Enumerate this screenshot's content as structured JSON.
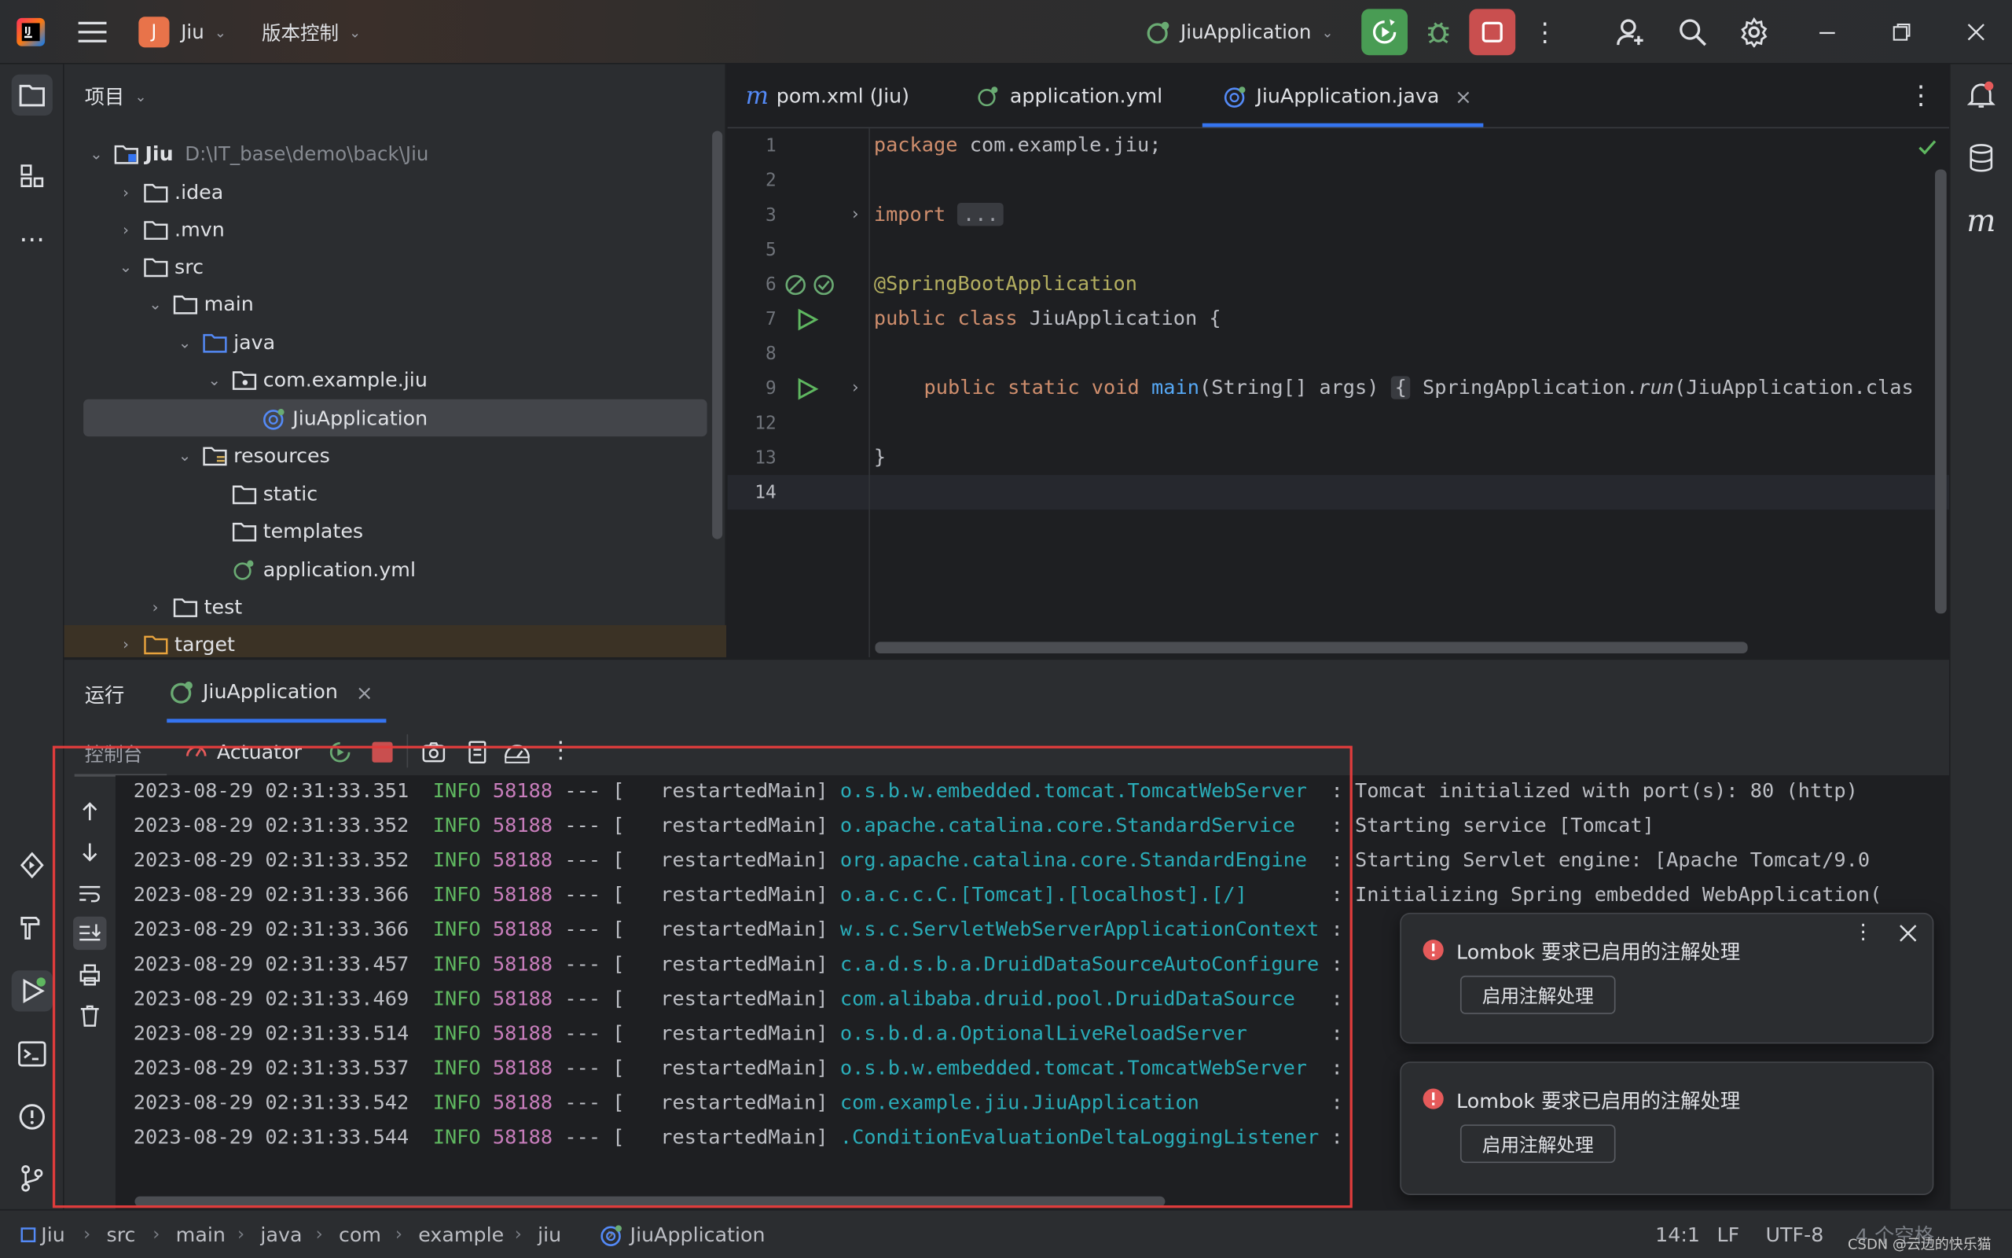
{
  "titlebar": {
    "project_initial": "J",
    "project_name": "Jiu",
    "vcs_label": "版本控制",
    "run_config": "JiuApplication"
  },
  "project_panel": {
    "title": "项目",
    "tree": [
      {
        "label": "Jiu",
        "path": "D:\\IT_base\\demo\\back\\Jiu"
      },
      {
        "label": ".idea"
      },
      {
        "label": ".mvn"
      },
      {
        "label": "src"
      },
      {
        "label": "main"
      },
      {
        "label": "java"
      },
      {
        "label": "com.example.jiu"
      },
      {
        "label": "JiuApplication"
      },
      {
        "label": "resources"
      },
      {
        "label": "static"
      },
      {
        "label": "templates"
      },
      {
        "label": "application.yml"
      },
      {
        "label": "test"
      },
      {
        "label": "target"
      }
    ]
  },
  "editor": {
    "tabs": [
      {
        "label": "pom.xml (Jiu)"
      },
      {
        "label": "application.yml"
      },
      {
        "label": "JiuApplication.java"
      }
    ],
    "line_numbers": [
      "1",
      "2",
      "3",
      "5",
      "6",
      "7",
      "8",
      "9",
      "12",
      "13",
      "14"
    ],
    "code": {
      "l1_kw": "package",
      "l1_rest": " com.example.jiu;",
      "l3_kw": "import",
      "l3_fold": "...",
      "l6": "@SpringBootApplication",
      "l7_kw": "public class",
      "l7_rest": " JiuApplication {",
      "l9_kw": "public static void",
      "l9_fn": "main",
      "l9_args": "(String[] args)",
      "l9_brace": "{",
      "l9_call_a": " SpringApplication.",
      "l9_call_run": "run",
      "l9_call_b": "(JiuApplication.clas",
      "l13": "}"
    }
  },
  "run_panel": {
    "title": "运行",
    "tab_label": "JiuApplication",
    "console_tab": "控制台",
    "actuator_tab": "Actuator",
    "logs": [
      {
        "ts": "2023-08-29 02:31:33.351",
        "lvl": "INFO",
        "pid": "58188",
        "sep": "--- [",
        "thr": "  restartedMain]",
        "cls": "o.s.b.w.embedded.tomcat.TomcatWebServer ",
        "msg": " : Tomcat initialized with port(s): 80 (http)"
      },
      {
        "ts": "2023-08-29 02:31:33.352",
        "lvl": "INFO",
        "pid": "58188",
        "sep": "--- [",
        "thr": "  restartedMain]",
        "cls": "o.apache.catalina.core.StandardService  ",
        "msg": " : Starting service [Tomcat]"
      },
      {
        "ts": "2023-08-29 02:31:33.352",
        "lvl": "INFO",
        "pid": "58188",
        "sep": "--- [",
        "thr": "  restartedMain]",
        "cls": "org.apache.catalina.core.StandardEngine ",
        "msg": " : Starting Servlet engine: [Apache Tomcat/9.0"
      },
      {
        "ts": "2023-08-29 02:31:33.366",
        "lvl": "INFO",
        "pid": "58188",
        "sep": "--- [",
        "thr": "  restartedMain]",
        "cls": "o.a.c.c.C.[Tomcat].[localhost].[/]      ",
        "msg": " : Initializing Spring embedded WebApplication("
      },
      {
        "ts": "2023-08-29 02:31:33.366",
        "lvl": "INFO",
        "pid": "58188",
        "sep": "--- [",
        "thr": "  restartedMain]",
        "cls": "w.s.c.ServletWebServerApplicationContext",
        "msg": " :"
      },
      {
        "ts": "2023-08-29 02:31:33.457",
        "lvl": "INFO",
        "pid": "58188",
        "sep": "--- [",
        "thr": "  restartedMain]",
        "cls": "c.a.d.s.b.a.DruidDataSourceAutoConfigure",
        "msg": " :"
      },
      {
        "ts": "2023-08-29 02:31:33.469",
        "lvl": "INFO",
        "pid": "58188",
        "sep": "--- [",
        "thr": "  restartedMain]",
        "cls": "com.alibaba.druid.pool.DruidDataSource  ",
        "msg": " :"
      },
      {
        "ts": "2023-08-29 02:31:33.514",
        "lvl": "INFO",
        "pid": "58188",
        "sep": "--- [",
        "thr": "  restartedMain]",
        "cls": "o.s.b.d.a.OptionalLiveReloadServer      ",
        "msg": " :"
      },
      {
        "ts": "2023-08-29 02:31:33.537",
        "lvl": "INFO",
        "pid": "58188",
        "sep": "--- [",
        "thr": "  restartedMain]",
        "cls": "o.s.b.w.embedded.tomcat.TomcatWebServer ",
        "msg": " :"
      },
      {
        "ts": "2023-08-29 02:31:33.542",
        "lvl": "INFO",
        "pid": "58188",
        "sep": "--- [",
        "thr": "  restartedMain]",
        "cls": "com.example.jiu.JiuApplication          ",
        "msg": " :"
      },
      {
        "ts": "2023-08-29 02:31:33.544",
        "lvl": "INFO",
        "pid": "58188",
        "sep": "--- [",
        "thr": "  restartedMain]",
        "cls": ".ConditionEvaluationDeltaLoggingListener",
        "msg": " :"
      }
    ]
  },
  "notifications": [
    {
      "title": "Lombok 要求已启用的注解处理",
      "action": "启用注解处理"
    },
    {
      "title": "Lombok 要求已启用的注解处理",
      "action": "启用注解处理"
    }
  ],
  "statusbar": {
    "breadcrumbs": [
      "Jiu",
      "src",
      "main",
      "java",
      "com",
      "example",
      "jiu",
      "JiuApplication"
    ],
    "position": "14:1",
    "line_sep": "LF",
    "encoding": "UTF-8",
    "indent": "4 个空格",
    "watermark": "CSDN @云边的快乐猫"
  },
  "colors": {
    "accent": "#3574f0",
    "run_green": "#499c54",
    "stop_red": "#c94f4f",
    "highlight_box": "#e03c3c"
  }
}
